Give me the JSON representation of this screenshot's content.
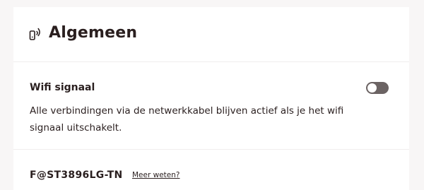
{
  "header": {
    "title": "Algemeen",
    "icon": "router-icon"
  },
  "wifi_setting": {
    "title": "Wifi signaal",
    "description": "Alle verbindingen via de netwerkkabel blijven actief als je het wifi signaal uitschakelt.",
    "toggle_on": false
  },
  "network": {
    "name": "F@ST3896LG-TN",
    "more_link": "Meer weten?"
  },
  "colors": {
    "background": "#f8f6f6",
    "card": "#ffffff",
    "text": "#2a1f1f",
    "toggle_off": "#6b6363"
  }
}
